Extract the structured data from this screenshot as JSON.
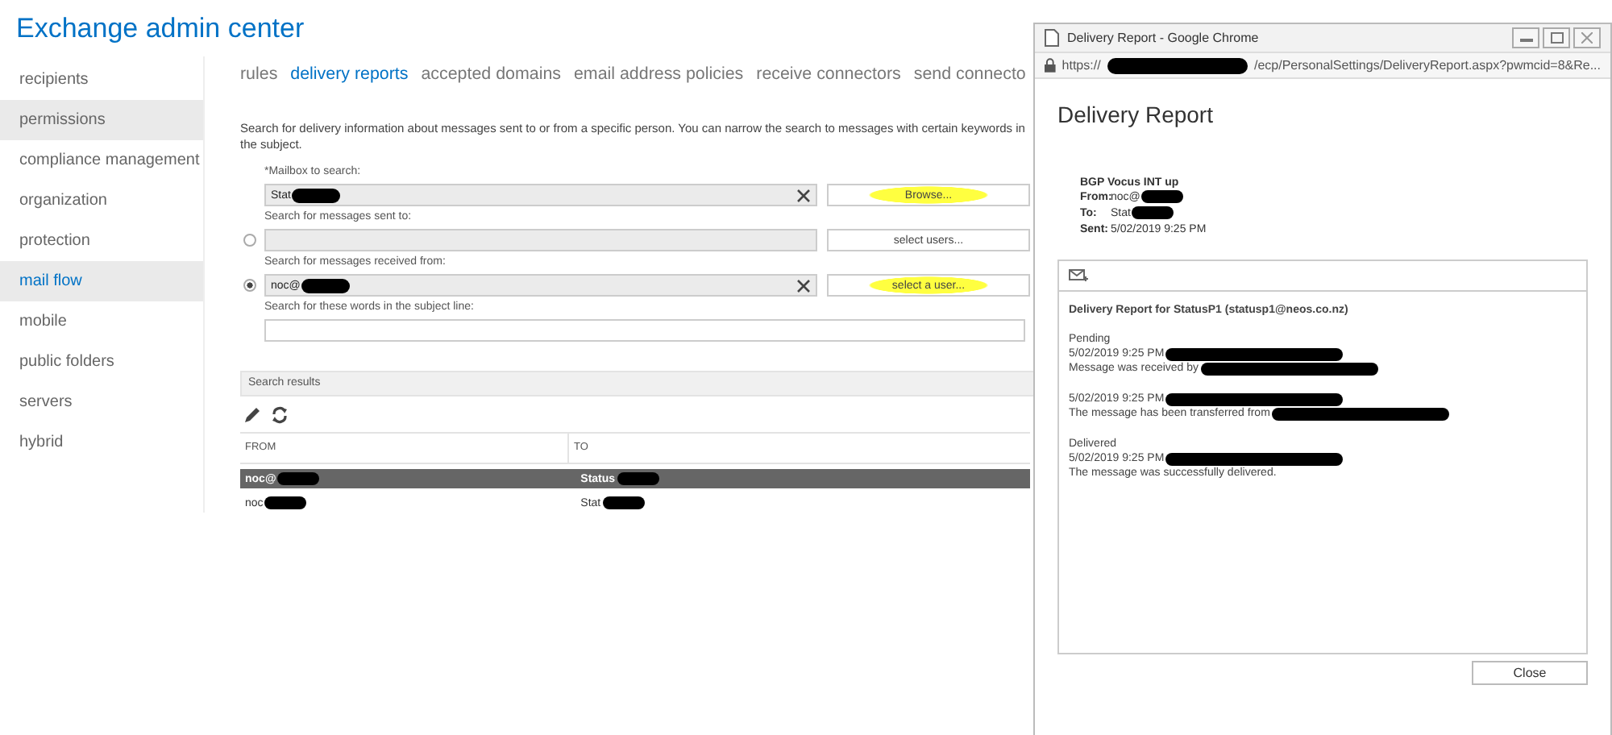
{
  "app_title": "Exchange admin center",
  "sidebar": {
    "items": [
      {
        "label": "recipients",
        "selected": false,
        "hovered": false
      },
      {
        "label": "permissions",
        "selected": false,
        "hovered": true
      },
      {
        "label": "compliance management",
        "selected": false,
        "hovered": false
      },
      {
        "label": "organization",
        "selected": false,
        "hovered": false
      },
      {
        "label": "protection",
        "selected": false,
        "hovered": false
      },
      {
        "label": "mail flow",
        "selected": true,
        "hovered": false
      },
      {
        "label": "mobile",
        "selected": false,
        "hovered": false
      },
      {
        "label": "public folders",
        "selected": false,
        "hovered": false
      },
      {
        "label": "servers",
        "selected": false,
        "hovered": false
      },
      {
        "label": "hybrid",
        "selected": false,
        "hovered": false
      }
    ]
  },
  "tabs": [
    {
      "label": "rules",
      "selected": false
    },
    {
      "label": "delivery reports",
      "selected": true
    },
    {
      "label": "accepted domains",
      "selected": false
    },
    {
      "label": "email address policies",
      "selected": false
    },
    {
      "label": "receive connectors",
      "selected": false
    },
    {
      "label": "send connecto",
      "selected": false
    }
  ],
  "description": "Search for delivery information about messages sent to or from a specific person. You can narrow the search to messages with certain keywords in the subject.",
  "form": {
    "fields": [
      {
        "label": "*Mailbox to search:",
        "value": "Stat",
        "redacted": true,
        "clearable": true,
        "button": "Browse...",
        "highlighted": true
      },
      {
        "label": "Search for messages sent to:",
        "redacted": false,
        "clearable": false,
        "radio_selected": false,
        "button": "select users...",
        "highlighted": false
      },
      {
        "label": "Search for messages received from:",
        "value": "noc@",
        "redacted": true,
        "clearable": true,
        "radio_selected": true,
        "button": "select a user...",
        "highlighted": true
      },
      {
        "label": "Search for these words in the subject line:",
        "redacted": false,
        "clearable": false
      }
    ]
  },
  "results": {
    "title": "Search results",
    "columns": [
      "FROM",
      "TO"
    ],
    "rows": [
      {
        "from": "noc@",
        "to": "Status",
        "selected": true
      },
      {
        "from": "noc",
        "to": "Stat",
        "selected": false
      }
    ]
  },
  "popup": {
    "title": "Delivery Report - Google Chrome",
    "url_start": "https://",
    "url_end": "/ecp/PersonalSettings/DeliveryReport.aspx?pwmcid=8&Re...",
    "heading": "Delivery Report",
    "subject": "BGP Vocus INT up",
    "meta": [
      {
        "label": "From:",
        "value": "noc@",
        "redacted": true
      },
      {
        "label": "To:",
        "value": "Stat",
        "redacted": true
      },
      {
        "label": "Sent:",
        "value": "5/02/2019 9:25 PM"
      }
    ],
    "report_title": "Delivery Report for  StatusP1 (statusp1@neos.co.nz)",
    "events": [
      {
        "status": "Pending",
        "time": "5/02/2019 9:25 PM",
        "message": "Message was received by"
      },
      {
        "time": "5/02/2019 9:25 PM",
        "message": "The message has been transferred from"
      },
      {
        "status": "Delivered",
        "time": "5/02/2019 9:25 PM",
        "message": "The message was successfully delivered."
      }
    ],
    "close_button": "Close"
  }
}
